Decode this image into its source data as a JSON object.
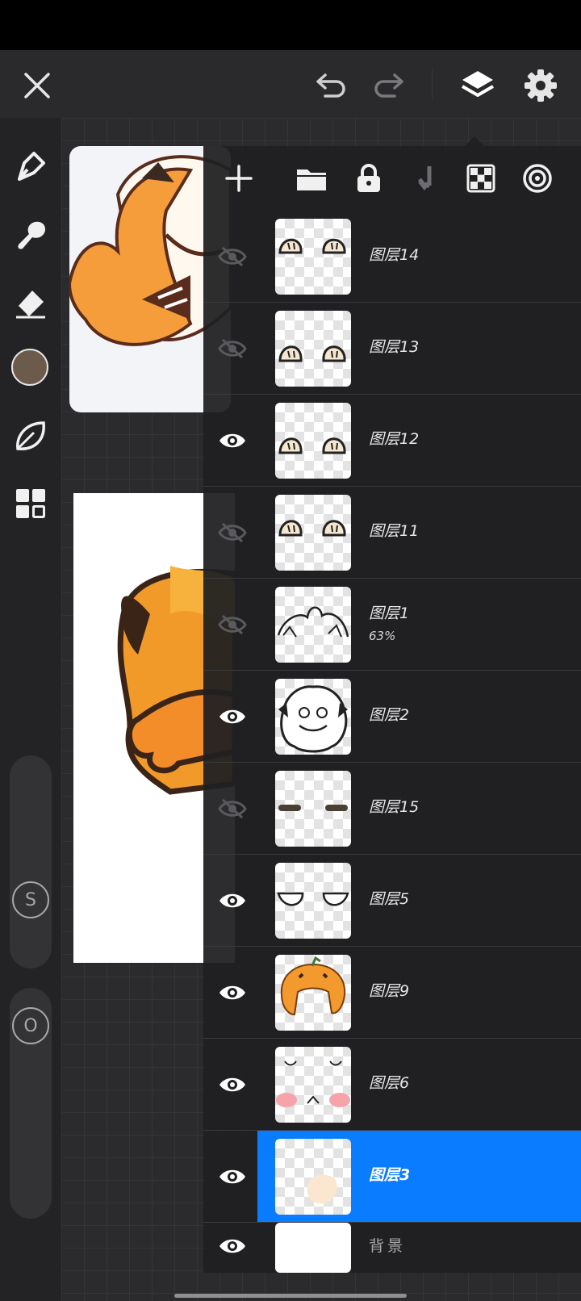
{
  "top_bar": {
    "icons": [
      "close-icon",
      "undo-icon",
      "redo-icon",
      "layers-icon",
      "settings-icon"
    ]
  },
  "tools": [
    "brush-icon",
    "smudge-icon",
    "eraser-icon",
    "color-swatch",
    "select-icon",
    "gallery-icon"
  ],
  "colors": {
    "current_color": "#6c5a4a",
    "selection_blue": "#0a7cff",
    "panel_bg": "#202022"
  },
  "sliders": {
    "size_label": "S",
    "opacity_label": "O"
  },
  "layers_panel": {
    "toolbar_icons": [
      "add-layer-icon",
      "folder-icon",
      "lock-icon",
      "merge-down-icon",
      "alpha-lock-icon",
      "mask-icon"
    ],
    "layers": [
      {
        "name": "图层14",
        "visible": false,
        "opacity": ""
      },
      {
        "name": "图层13",
        "visible": false,
        "opacity": ""
      },
      {
        "name": "图层12",
        "visible": true,
        "opacity": ""
      },
      {
        "name": "图层11",
        "visible": false,
        "opacity": ""
      },
      {
        "name": "图层1",
        "visible": false,
        "opacity": "63%"
      },
      {
        "name": "图层2",
        "visible": true,
        "opacity": ""
      },
      {
        "name": "图层15",
        "visible": false,
        "opacity": ""
      },
      {
        "name": "图层5",
        "visible": true,
        "opacity": ""
      },
      {
        "name": "图层9",
        "visible": true,
        "opacity": ""
      },
      {
        "name": "图层6",
        "visible": true,
        "opacity": ""
      },
      {
        "name": "图层3",
        "visible": true,
        "opacity": "",
        "selected": true
      },
      {
        "name": "背景",
        "visible": true,
        "opacity": ""
      }
    ]
  }
}
